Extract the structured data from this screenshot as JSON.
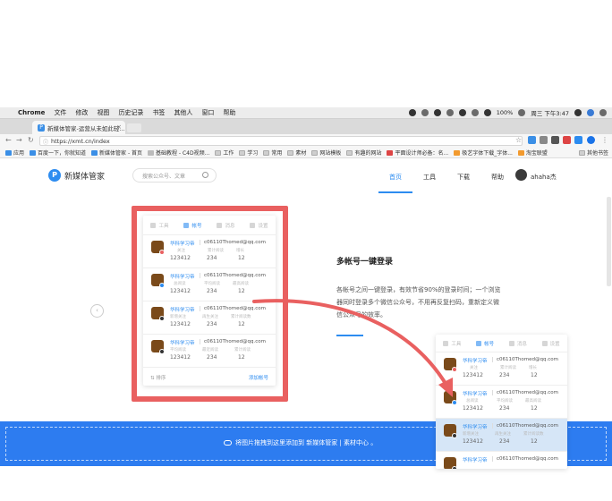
{
  "menubar": {
    "app": "Chrome",
    "items": [
      "文件",
      "修改",
      "视图",
      "历史记录",
      "书签",
      "其他人",
      "窗口",
      "帮助"
    ],
    "battery": "100%",
    "clock": "周三 下午3:47"
  },
  "tab": {
    "title": "新媒体管家-运营从未如此轻..."
  },
  "address": {
    "url": "https://xmt.cn/index"
  },
  "bookmarks": [
    {
      "label": "应用",
      "icon": "apps-icon"
    },
    {
      "label": "百度一下，你就知道",
      "icon": "baidu-icon"
    },
    {
      "label": "新媒体管家 - 首页",
      "icon": "xmt-icon"
    },
    {
      "label": "基础教程 - C4D视频...",
      "icon": "c4d-icon"
    },
    {
      "label": "工作",
      "icon": "folder-icon"
    },
    {
      "label": "学习",
      "icon": "folder-icon"
    },
    {
      "label": "常用",
      "icon": "folder-icon"
    },
    {
      "label": "素材",
      "icon": "folder-icon"
    },
    {
      "label": "网站模板",
      "icon": "folder-icon"
    },
    {
      "label": "有趣的网站",
      "icon": "folder-icon"
    },
    {
      "label": "平面设计师必备：名...",
      "icon": "design-icon"
    },
    {
      "label": "极艺字体下载_字体...",
      "icon": "font-icon"
    },
    {
      "label": "淘宝联盟",
      "icon": "taobao-icon"
    },
    {
      "label": "其他书签",
      "icon": "folder-icon"
    }
  ],
  "site": {
    "logo_letter": "P",
    "brand": "新媒体管家",
    "search_placeholder": "搜索公众号、文章",
    "nav": [
      "首页",
      "工具",
      "下载",
      "帮助"
    ],
    "username": "ahaha杰"
  },
  "feature": {
    "title": "多帐号一键登录",
    "desc": "各帐号之间一键登录，有效节省90%的登录时间；一个浏览器同时登录多个微信公众号，不用再反复扫码，重新定义微信公众号的效率。"
  },
  "carousel": {
    "prev_label": "‹"
  },
  "panel": {
    "tabs": [
      {
        "label": "工具",
        "icon": "tools-icon",
        "active": false
      },
      {
        "label": "帐号",
        "icon": "account-icon",
        "active": true
      },
      {
        "label": "消息",
        "icon": "message-icon",
        "active": false
      },
      {
        "label": "设置",
        "icon": "settings-icon",
        "active": false
      }
    ],
    "accounts": [
      {
        "name": "华科学习帝",
        "email": "c06110Thomed@qq.com",
        "labels": [
          "关注",
          "累计阅读",
          "增长"
        ],
        "values": [
          "123412",
          "234",
          "12"
        ],
        "badge_color": "#e96060"
      },
      {
        "name": "华科学习帝",
        "email": "c06110Thomed@qq.com",
        "labels": [
          "总阅读",
          "平均阅读",
          "最高阅读"
        ],
        "values": [
          "123412",
          "234",
          "12"
        ],
        "badge_color": "#2d8cf0"
      },
      {
        "name": "华科学习帝",
        "email": "c06110Thomed@qq.com",
        "labels": [
          "新增关注",
          "再生关注",
          "累计阅读数"
        ],
        "values": [
          "123412",
          "234",
          "12"
        ],
        "badge_color": "#333333"
      },
      {
        "name": "华科学习帝",
        "email": "c06110Thomed@qq.com",
        "labels": [
          "平均阅读",
          "最近阅读",
          "累计阅读"
        ],
        "values": [
          "123412",
          "234",
          "12"
        ],
        "badge_color": "#333333"
      }
    ],
    "footer": {
      "sort": "排序",
      "add": "添加帐号"
    }
  },
  "upload": {
    "text": "将图片拖拽到这里添加到 新媒体管家 | 素材中心 。"
  }
}
